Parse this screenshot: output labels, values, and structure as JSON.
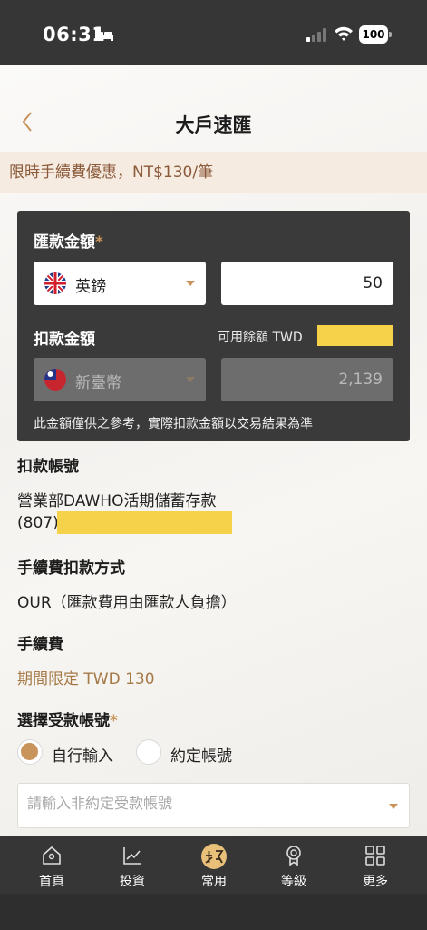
{
  "status_bar": {
    "time": "06:31",
    "battery": "100"
  },
  "header": {
    "title": "大戶速匯"
  },
  "promo": {
    "text": "限時手續費優惠，NT$130/筆"
  },
  "remit": {
    "label": "匯款金額",
    "required_mark": "*",
    "currency": "英鎊",
    "amount": "50"
  },
  "debit": {
    "label": "扣款金額",
    "available_label": "可用餘額 TWD",
    "currency": "新臺幣",
    "amount": "2,139",
    "note": "此金額僅供之參考，實際扣款金額以交易結果為準"
  },
  "debit_account": {
    "heading": "扣款帳號",
    "name": "營業部DAWHO活期儲蓄存款",
    "code": "(807)"
  },
  "fee_method": {
    "heading": "手續費扣款方式",
    "value": "OUR（匯款費用由匯款人負擔）"
  },
  "fee": {
    "heading": "手續費",
    "value": "期間限定 TWD 130"
  },
  "payee": {
    "heading": "選擇受款帳號",
    "required_mark": "*",
    "option_manual": "自行輸入",
    "option_preset": "約定帳號",
    "placeholder": "請輸入非約定受款帳號"
  },
  "nav": {
    "items": [
      {
        "label": "首頁",
        "icon": "home-icon"
      },
      {
        "label": "投資",
        "icon": "chart-icon"
      },
      {
        "label": "常用",
        "icon": "dawho-logo-icon"
      },
      {
        "label": "等級",
        "icon": "badge-icon"
      },
      {
        "label": "更多",
        "icon": "grid-icon"
      }
    ]
  },
  "colors": {
    "accent": "#c9945b",
    "dark": "#3a3a3a",
    "promo_bg": "#f6ebe0",
    "redaction": "#f6d24a"
  }
}
